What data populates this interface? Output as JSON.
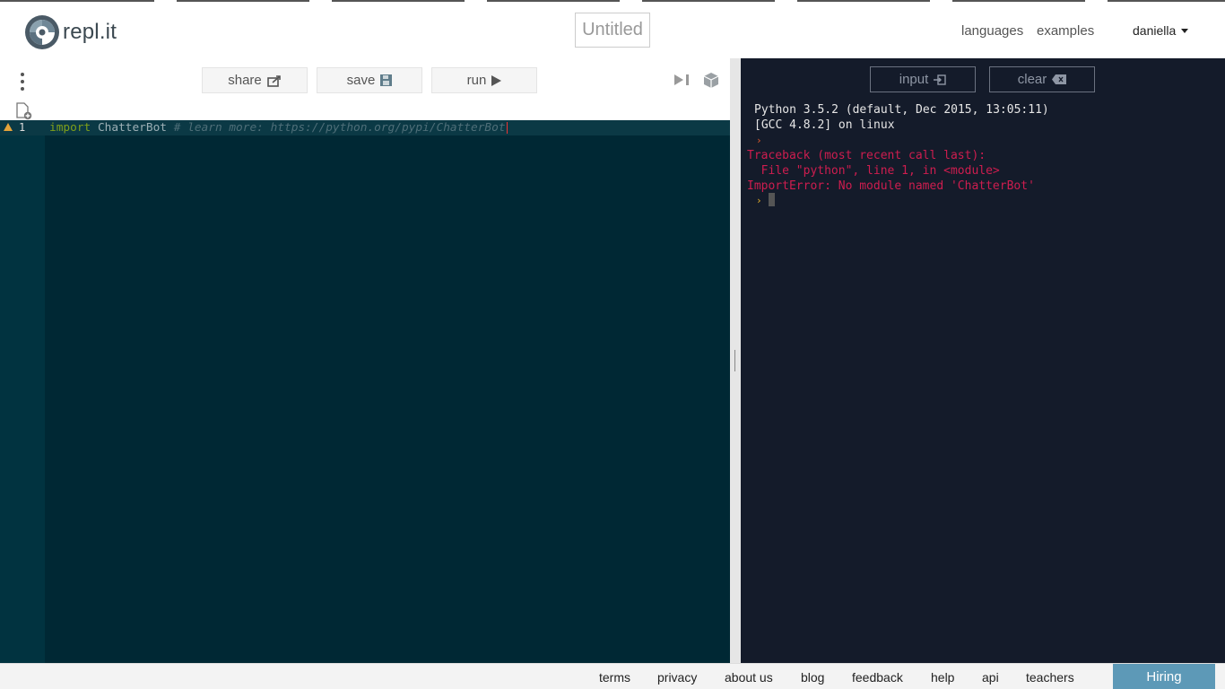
{
  "header": {
    "logo_text": "repl.it",
    "file_title": "Untitled",
    "nav": {
      "languages": "languages",
      "examples": "examples"
    },
    "user": "daniella"
  },
  "toolbar": {
    "share_label": "share",
    "save_label": "save",
    "run_label": "run"
  },
  "editor": {
    "line_number": "1",
    "code": {
      "keyword": "import",
      "identifier": "ChatterBot",
      "comment": "# learn more: https://python.org/pypi/ChatterBot"
    }
  },
  "console": {
    "input_label": "input",
    "clear_label": "clear",
    "lines": {
      "version": "Python 3.5.2 (default, Dec 2015, 13:05:11)",
      "gcc": "[GCC 4.8.2] on linux",
      "traceback": "Traceback (most recent call last):",
      "file": "  File \"python\", line 1, in <module>",
      "error": "ImportError: No module named 'ChatterBot'"
    },
    "prompt_glyph": "›"
  },
  "footer": {
    "links": {
      "terms": "terms",
      "privacy": "privacy",
      "about": "about us",
      "blog": "blog",
      "feedback": "feedback",
      "help": "help",
      "api": "api",
      "teachers": "teachers"
    },
    "hiring": "Hiring"
  },
  "colors": {
    "editor_bg": "#002834",
    "console_bg": "#141b2a",
    "error_red": "#ce1d4f",
    "hiring_blue": "#5d99b7"
  }
}
